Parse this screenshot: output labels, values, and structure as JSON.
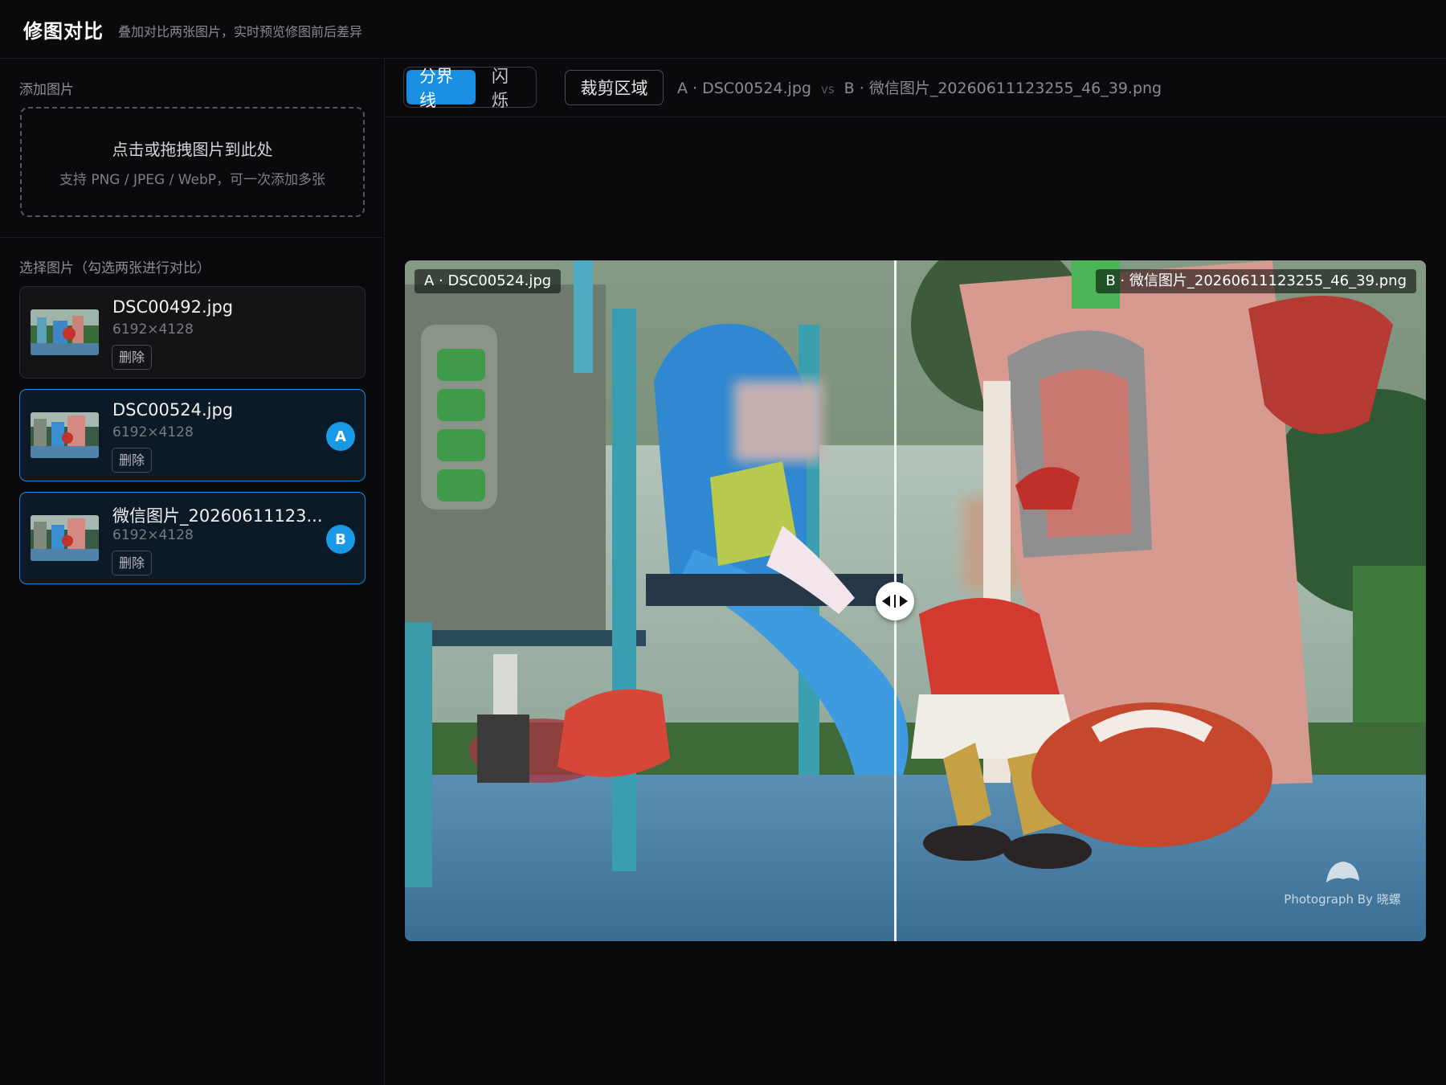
{
  "header": {
    "title": "修图对比",
    "subtitle": "叠加对比两张图片，实时预览修图前后差异"
  },
  "sidebar": {
    "add_label": "添加图片",
    "dropzone": {
      "title": "点击或拖拽图片到此处",
      "hint": "支持 PNG / JPEG / WebP，可一次添加多张"
    },
    "select_label": "选择图片（勾选两张进行对比）",
    "files": [
      {
        "name": "DSC00492.jpg",
        "dims": "6192×4128",
        "delete_label": "删除",
        "slot": ""
      },
      {
        "name": "DSC00524.jpg",
        "dims": "6192×4128",
        "delete_label": "删除",
        "slot": "A"
      },
      {
        "name": "微信图片_20260611123...",
        "dims": "6192×4128",
        "delete_label": "删除",
        "slot": "B"
      }
    ]
  },
  "toolbar": {
    "modes": [
      "分界线",
      "闪烁"
    ],
    "active_mode": "分界线",
    "crop_label": "裁剪区域",
    "compare": {
      "a": "A · DSC00524.jpg",
      "vs": "vs",
      "b": "B · 微信图片_20260611123255_46_39.png"
    }
  },
  "viewer": {
    "label_a": "A · DSC00524.jpg",
    "label_b": "B · 微信图片_20260611123255_46_39.png",
    "watermark": "Photograph By 晓螺",
    "split_position": 0.48
  },
  "colors": {
    "accent": "#1a8ee0",
    "background": "#0a0a0c"
  }
}
